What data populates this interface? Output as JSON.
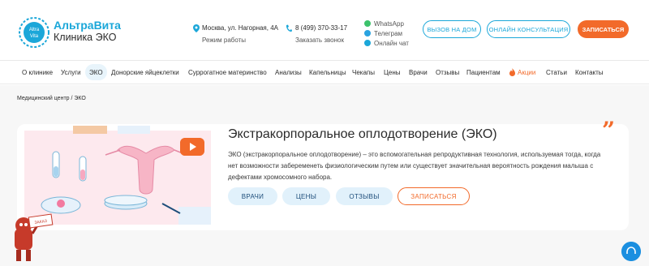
{
  "header": {
    "brand_name": "АльтраВита",
    "brand_sub": "Клиника ЭКО",
    "logo_text_top": "Altra",
    "logo_text_bottom": "Vita",
    "address": "Москва, ул. Нагорная, 4А",
    "hours": "Режим работы",
    "phone": "8 (499) 370-33-17",
    "callback": "Заказать звонок",
    "messengers": [
      {
        "label": "WhatsApp",
        "color": "#3cc26b"
      },
      {
        "label": "Телеграм",
        "color": "#2aa3e0"
      },
      {
        "label": "Онлайн чат",
        "color": "#1ba7d9"
      }
    ],
    "btn_home": "ВЫЗОВ НА ДОМ",
    "btn_online": "ОНЛАЙН КОНСУЛЬТАЦИЯ",
    "btn_signup": "ЗАПИСАТЬСЯ"
  },
  "nav": {
    "items": [
      "О клинике",
      "Услуги",
      "ЭКО",
      "Донорские яйцеклетки",
      "Суррогатное материнство",
      "Анализы",
      "Капельницы",
      "Чекапы",
      "Цены",
      "Врачи",
      "Отзывы",
      "Пациентам",
      "Акции",
      "Статьи",
      "Контакты"
    ]
  },
  "breadcrumb": "Медицинский центр  /  ЭКО",
  "main": {
    "title": "Экстракорпоральное оплодотворение (ЭКО)",
    "description": "ЭКО (экстракорпоральное оплодотворение) – это вспомогательная репродуктивная технология, используемая тогда, когда нет возможности забеременеть физиологическим путем или существует значительная вероятность рождения малыша с дефектами хромосомного набора.",
    "buttons": [
      "ВРАЧИ",
      "ЦЕНЫ",
      "ОТЗЫВЫ",
      "ЗАПИСАТЬСЯ"
    ]
  },
  "mascot_sign": "ЗАКАЗ",
  "colors": {
    "brand": "#1ba7d9",
    "accent": "#f26a2a",
    "pill_bg": "#e1f1fb"
  }
}
